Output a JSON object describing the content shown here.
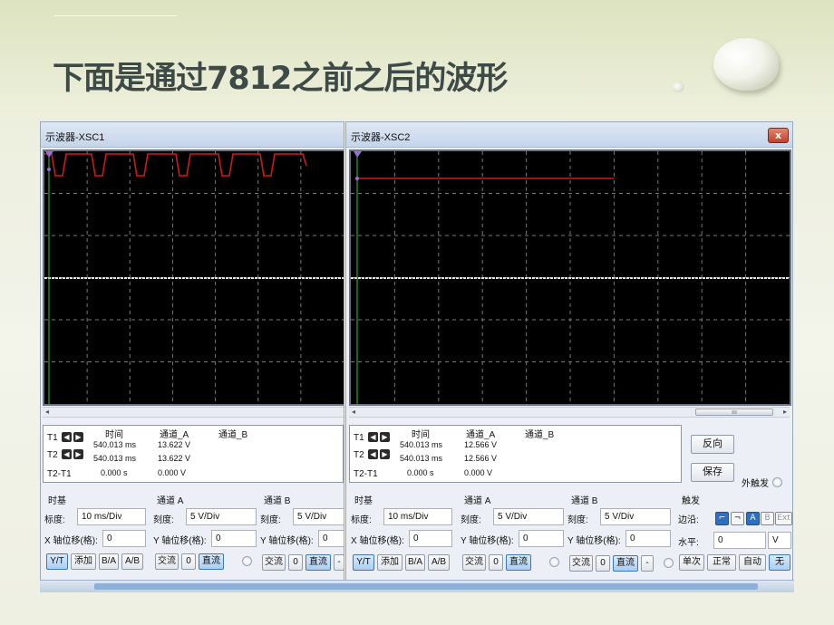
{
  "slide": {
    "title": "下面是通过7812之前之后的波形"
  },
  "colors": {
    "trace_red": "#cc1b1b",
    "trace_white": "#e6e6e6",
    "grid": "#7a7a7a",
    "cursor_green": "#35c43a",
    "marker_violet": "#9c6bd6"
  },
  "scope1": {
    "title": "示波器-XSC1",
    "readout": {
      "headers": [
        "时间",
        "通道_A",
        "通道_B"
      ],
      "rows": [
        {
          "label": "T1",
          "time": "540.013 ms",
          "a": "13.622 V",
          "b": ""
        },
        {
          "label": "T2",
          "time": "540.013 ms",
          "a": "13.622 V",
          "b": ""
        },
        {
          "label": "T2-T1",
          "time": "0.000 s",
          "a": "0.000 V",
          "b": ""
        }
      ]
    },
    "timebase": {
      "title": "时基",
      "scale_label": "标度:",
      "scale": "10 ms/Div",
      "xpos_label": "X 轴位移(格):",
      "xpos": "0",
      "buttons": [
        "Y/T",
        "添加",
        "B/A",
        "A/B"
      ]
    },
    "channel_a": {
      "title": "通道 A",
      "scale_label": "刻度:",
      "scale": "5 V/Div",
      "ypos_label": "Y 轴位移(格):",
      "ypos": "0",
      "buttons": [
        "交流",
        "0",
        "直流"
      ]
    },
    "channel_b": {
      "title": "通道 B",
      "scale_label": "刻度:",
      "scale": "5 V/Div",
      "ypos_label": "Y 轴位移(格):",
      "ypos": "0",
      "buttons": [
        "交流",
        "0",
        "直流",
        "-"
      ]
    }
  },
  "scope2": {
    "title": "示波器-XSC2",
    "close": "x",
    "readout": {
      "headers": [
        "时间",
        "通道_A",
        "通道_B"
      ],
      "rows": [
        {
          "label": "T1",
          "time": "540.013 ms",
          "a": "12.566 V",
          "b": ""
        },
        {
          "label": "T2",
          "time": "540.013 ms",
          "a": "12.566 V",
          "b": ""
        },
        {
          "label": "T2-T1",
          "time": "0.000 s",
          "a": "0.000 V",
          "b": ""
        }
      ]
    },
    "reverse_button": "反向",
    "save_button": "保存",
    "ext_trigger": "外触发",
    "timebase": {
      "title": "时基",
      "scale_label": "标度:",
      "scale": "10 ms/Div",
      "xpos_label": "X 轴位移(格):",
      "xpos": "0",
      "buttons": [
        "Y/T",
        "添加",
        "B/A",
        "A/B"
      ]
    },
    "channel_a": {
      "title": "通道 A",
      "scale_label": "刻度:",
      "scale": "5 V/Div",
      "ypos_label": "Y 轴位移(格):",
      "ypos": "0",
      "buttons": [
        "交流",
        "0",
        "直流"
      ]
    },
    "channel_b": {
      "title": "通道 B",
      "scale_label": "刻度:",
      "scale": "5 V/Div",
      "ypos_label": "Y 轴位移(格):",
      "ypos": "0",
      "buttons": [
        "交流",
        "0",
        "直流",
        "-"
      ]
    },
    "trigger": {
      "title": "触发",
      "edge_label": "边沿:",
      "edge_buttons": [
        "A",
        "B",
        "Ext"
      ],
      "level_label": "水平:",
      "level": "0",
      "level_unit": "V",
      "mode_buttons": [
        "单次",
        "正常",
        "自动",
        "无"
      ]
    }
  }
}
